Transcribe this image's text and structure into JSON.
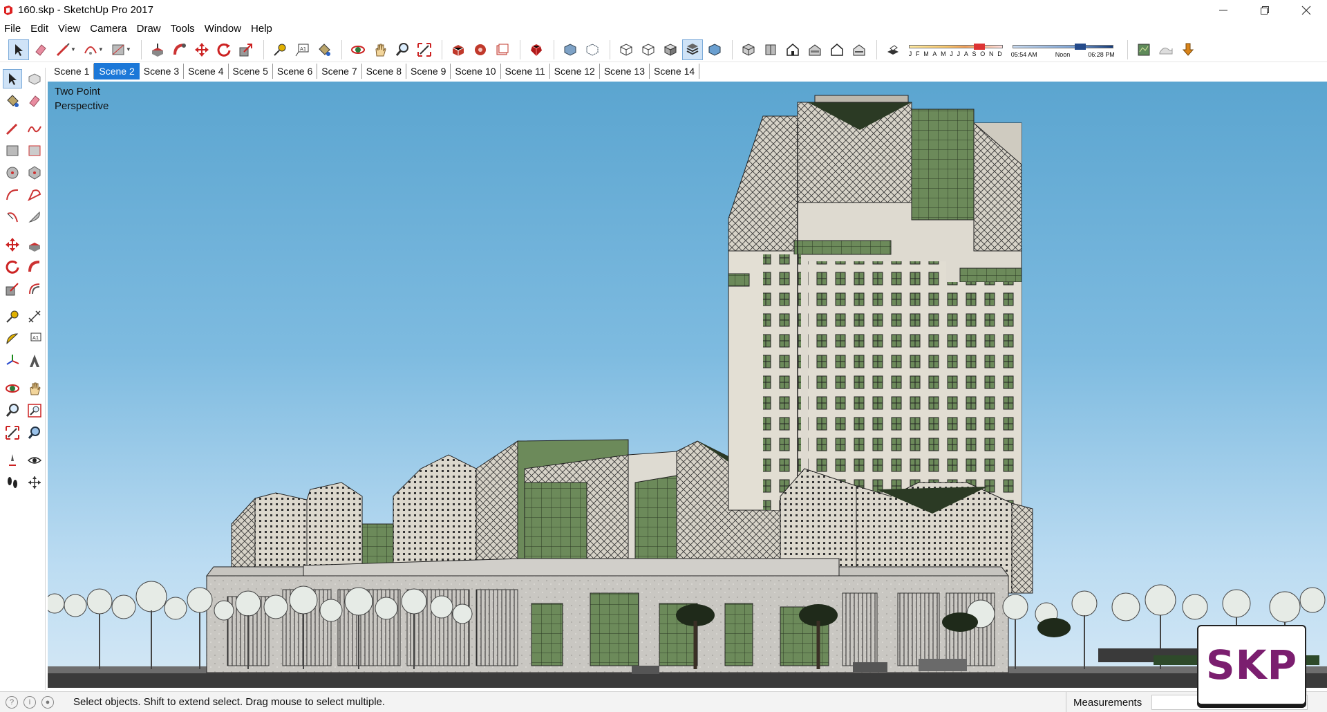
{
  "window": {
    "title": "160.skp - SketchUp Pro 2017"
  },
  "menu": {
    "items": [
      "File",
      "Edit",
      "View",
      "Camera",
      "Draw",
      "Tools",
      "Window",
      "Help"
    ]
  },
  "shadow": {
    "months": [
      "J",
      "F",
      "M",
      "A",
      "M",
      "J",
      "J",
      "A",
      "S",
      "O",
      "N",
      "D"
    ],
    "time_start": "05:54 AM",
    "time_mid": "Noon",
    "time_end": "06:28 PM"
  },
  "scenes": {
    "tabs": [
      "Scene 1",
      "Scene 2",
      "Scene 3",
      "Scene 4",
      "Scene 5",
      "Scene 6",
      "Scene 7",
      "Scene 8",
      "Scene 9",
      "Scene 10",
      "Scene 11",
      "Scene 12",
      "Scene 13",
      "Scene 14"
    ],
    "active": "Scene 2"
  },
  "viewport": {
    "camera_label_line1": "Two Point",
    "camera_label_line2": "Perspective"
  },
  "status": {
    "hint": "Select objects. Shift to extend select. Drag mouse to select multiple.",
    "measurements_label": "Measurements",
    "measurements_value": ""
  },
  "badge": {
    "text": "SKP"
  },
  "colors": {
    "accent": "#1c78d8",
    "badge_text": "#7b1e6f",
    "sky_top": "#5ba5d0",
    "sky_bottom": "#d5e8f5",
    "glass_green": "#6c8a5a"
  },
  "icons": {
    "top_toolbar": [
      "select-icon",
      "eraser-icon",
      "line-icon",
      "arc-icon",
      "rectangle-icon",
      "push-pull-icon",
      "follow-me-icon",
      "move-icon",
      "rotate-icon",
      "scale-icon",
      "tape-measure-icon",
      "text-icon",
      "paint-bucket-icon",
      "orbit-icon",
      "pan-icon",
      "zoom-icon",
      "zoom-extents-icon",
      "warehouse-icon",
      "extension-warehouse-icon",
      "layout-icon",
      "ruby-icon",
      "xray-icon",
      "back-edges-icon",
      "wireframe-icon",
      "hidden-line-icon",
      "shaded-icon",
      "shaded-textures-icon",
      "monochrome-icon",
      "iso-view-icon",
      "top-view-icon",
      "front-view-icon",
      "right-view-icon",
      "back-view-icon",
      "left-view-icon",
      "shadows-toggle-icon",
      "geolocation-icon",
      "sandbox-icon",
      "download-icon"
    ]
  }
}
